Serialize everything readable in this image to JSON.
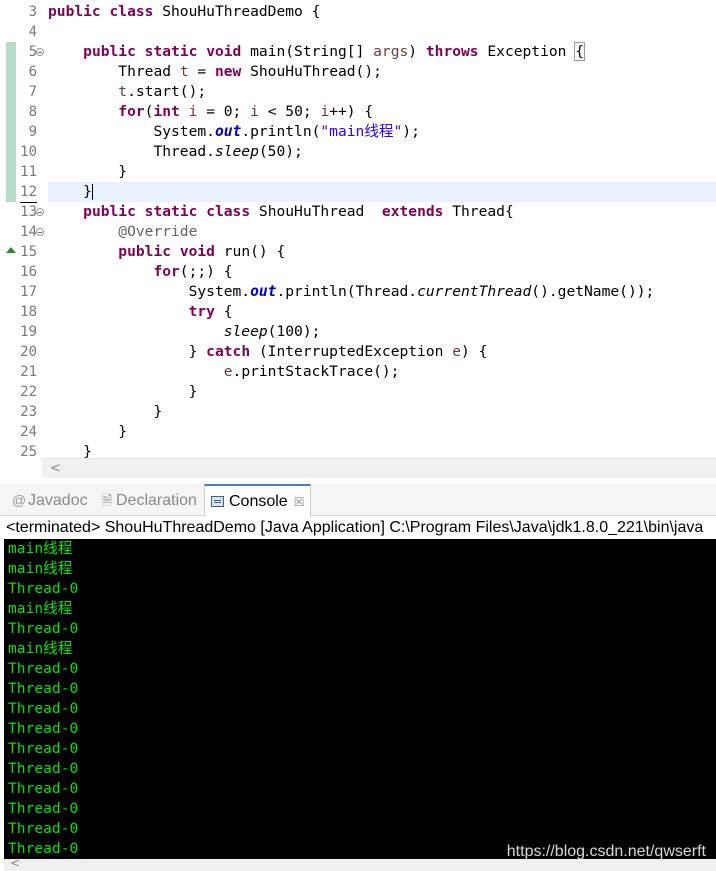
{
  "editor": {
    "line_numbers": [
      "3",
      "4",
      "5",
      "6",
      "7",
      "8",
      "9",
      "10",
      "11",
      "12",
      "13",
      "14",
      "15",
      "16",
      "17",
      "18",
      "19",
      "20",
      "21",
      "22",
      "23",
      "24",
      "25"
    ],
    "code": {
      "l3": {
        "kw1": "public",
        "kw2": "class",
        "name": " ShouHuThreadDemo {"
      },
      "l5": {
        "kw1": "public",
        "kw2": "static",
        "kw3": "void",
        "sig": " main(String[] ",
        "param": "args",
        "sig2": ") ",
        "kw4": "throws",
        "tail": " Exception ",
        "brace": "{"
      },
      "l6": {
        "a": "Thread ",
        "var": "t",
        "b": " = ",
        "kw": "new",
        "c": " ShouHuThread();"
      },
      "l7": {
        "var": "t",
        "a": ".start();"
      },
      "l8": {
        "kw1": "for",
        "a": "(",
        "kw2": "int",
        "b": " ",
        "v1": "i",
        "c": " = 0; ",
        "v2": "i",
        "d": " < 50; ",
        "v3": "i",
        "e": "++) {"
      },
      "l9": {
        "a": "System.",
        "field": "out",
        "b": ".println(",
        "str": "\"main线程\"",
        "c": ");"
      },
      "l10": {
        "a": "Thread.",
        "ital": "sleep",
        "b": "(50);"
      },
      "l11": {
        "a": "}"
      },
      "l12": {
        "a": "}"
      },
      "l13": {
        "kw1": "public",
        "kw2": "static",
        "kw3": "class",
        "a": " ShouHuThread  ",
        "kw4": "extends",
        "b": " Thread{"
      },
      "l14": {
        "ann": "@Override"
      },
      "l15": {
        "kw1": "public",
        "kw2": "void",
        "a": " run() {"
      },
      "l16": {
        "kw": "for",
        "a": "(;;) {"
      },
      "l17": {
        "a": "System.",
        "field": "out",
        "b": ".println(Thread.",
        "ital": "currentThread",
        "c": "().getName());"
      },
      "l18": {
        "kw": "try",
        "a": " {"
      },
      "l19": {
        "ital": "sleep",
        "a": "(100);"
      },
      "l20": {
        "a": "} ",
        "kw": "catch",
        "b": " (InterruptedException ",
        "var": "e",
        "c": ") {"
      },
      "l21": {
        "var": "e",
        "a": ".printStackTrace();"
      },
      "l22": {
        "a": "}"
      },
      "l23": {
        "a": "}"
      },
      "l24": {
        "a": "}"
      },
      "l25": {
        "a": "}"
      }
    },
    "scroll_left_glyph": "<"
  },
  "views": {
    "tabs": [
      {
        "icon": "@",
        "label": "Javadoc"
      },
      {
        "icon": "🗎",
        "label": "Declaration"
      },
      {
        "label": "Console",
        "close": "☒"
      }
    ]
  },
  "console": {
    "header": "<terminated> ShouHuThreadDemo [Java Application] C:\\Program Files\\Java\\jdk1.8.0_221\\bin\\java",
    "lines": [
      "main线程",
      "main线程",
      "Thread-0",
      "main线程",
      "Thread-0",
      "main线程",
      "Thread-0",
      "Thread-0",
      "Thread-0",
      "Thread-0",
      "Thread-0",
      "Thread-0",
      "Thread-0",
      "Thread-0",
      "Thread-0",
      "Thread-0"
    ],
    "text_color": "#00e400",
    "background": "#000000"
  },
  "watermark": "https://blog.csdn.net/qwserft"
}
